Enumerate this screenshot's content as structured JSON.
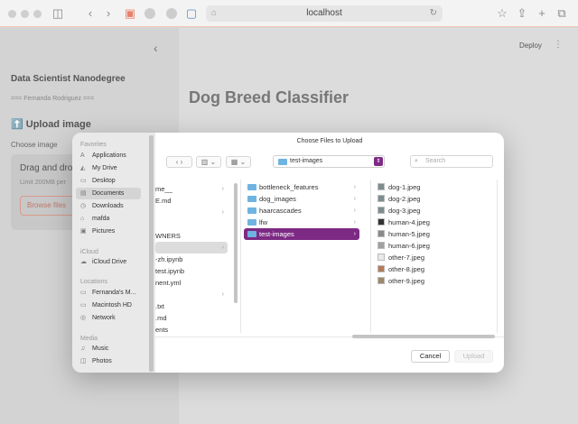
{
  "browser": {
    "url": "localhost",
    "addr_prefix": "⌂"
  },
  "app": {
    "deploy": "Deploy",
    "collapse": "‹",
    "sidebar_title": "Data Scientist Nanodegree",
    "author": "=== Fernanda Rodriguez ===",
    "upload_heading": "⬆️ Upload image",
    "choose_label": "Choose image",
    "drag_text": "Drag and drop",
    "limit_text": "Limit 200MB per",
    "browse": "Browse files",
    "main_title": "Dog Breed Classifier"
  },
  "dialog": {
    "title": "Choose Files to Upload",
    "path": "test-images",
    "search_placeholder": "Search",
    "cancel": "Cancel",
    "upload": "Upload",
    "sidebar": {
      "favorites_header": "Favorites",
      "favorites": [
        {
          "label": "Applications",
          "icon": "A"
        },
        {
          "label": "My Drive",
          "icon": "◭"
        },
        {
          "label": "Desktop",
          "icon": "▭"
        },
        {
          "label": "Documents",
          "icon": "▤"
        },
        {
          "label": "Downloads",
          "icon": "◷"
        },
        {
          "label": "mafda",
          "icon": "⌂"
        },
        {
          "label": "Pictures",
          "icon": "▣"
        }
      ],
      "icloud_header": "iCloud",
      "icloud": [
        {
          "label": "iCloud Drive",
          "icon": "☁"
        }
      ],
      "locations_header": "Locations",
      "locations": [
        {
          "label": "Fernanda's M...",
          "icon": "▭"
        },
        {
          "label": "Macintosh HD",
          "icon": "▭"
        },
        {
          "label": "Network",
          "icon": "◎"
        }
      ],
      "media_header": "Media",
      "media": [
        {
          "label": "Music",
          "icon": "♫"
        },
        {
          "label": "Photos",
          "icon": "◫"
        }
      ]
    },
    "col1": [
      "me__",
      "E.md",
      "",
      "",
      "WNERS",
      "",
      "-zh.ipynb",
      "test.ipynb",
      "nent.yml",
      "",
      ".txt",
      ".md",
      "ents"
    ],
    "col2": [
      "bottleneck_features",
      "dog_images",
      "haarcascades",
      "lfw",
      "test-images"
    ],
    "col3": [
      "dog-1.jpeg",
      "dog-2.jpeg",
      "dog-3.jpeg",
      "human-4.jpeg",
      "human-5.jpeg",
      "human-6.jpeg",
      "other-7.jpeg",
      "other-8.jpeg",
      "other-9.jpeg"
    ]
  }
}
